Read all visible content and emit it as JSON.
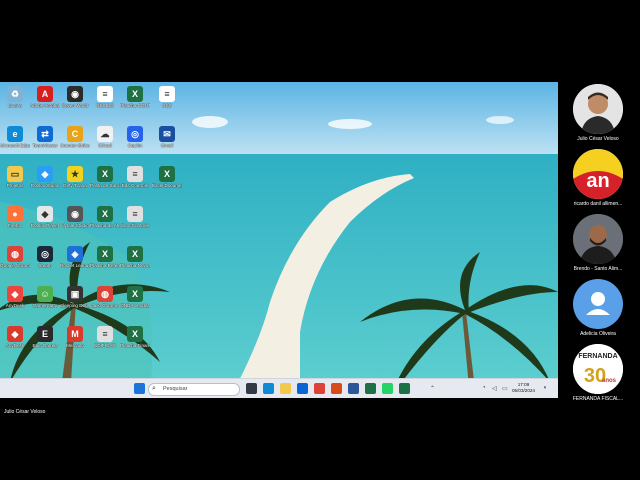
{
  "desktop": {
    "icons": [
      {
        "label": "Lixeira",
        "glyph": "♻",
        "color": "#7fb3d5"
      },
      {
        "label": "Adobe Acrobat",
        "glyph": "A",
        "color": "#d71f1f"
      },
      {
        "label": "Seven World",
        "glyph": "◉",
        "color": "#2b2b2b"
      },
      {
        "label": "RECIBO",
        "glyph": "≡",
        "color": "#ffffff"
      },
      {
        "label": "Planilha CONTROLE",
        "glyph": "X",
        "color": "#1e7145"
      },
      {
        "label": "CSS",
        "glyph": "≡",
        "color": "#ffffff"
      },
      {
        "label": "Microsoft Edge",
        "glyph": "e",
        "color": "#0f8bd6"
      },
      {
        "label": "TeamViewer",
        "glyph": "⇄",
        "color": "#0e6bd6"
      },
      {
        "label": "Counter-Strike 2",
        "glyph": "C",
        "color": "#e8a317"
      },
      {
        "label": "iCloud",
        "glyph": "☁",
        "color": "#f1f1f1"
      },
      {
        "label": "Copilot",
        "glyph": "◎",
        "color": "#2563eb"
      },
      {
        "label": "Gmail",
        "glyph": "✉",
        "color": "#1a4fa0"
      },
      {
        "label": "Projetos",
        "glyph": "▭",
        "color": "#f2c94c"
      },
      {
        "label": "Roblox Studio",
        "glyph": "◆",
        "color": "#2a9df4"
      },
      {
        "label": "Dirty Tirana",
        "glyph": "★",
        "color": "#f2d21e"
      },
      {
        "label": "Pasta de Sanches",
        "glyph": "X",
        "color": "#1e7145"
      },
      {
        "label": "Edit Controle",
        "glyph": "≡",
        "color": "#e0e0e0"
      },
      {
        "label": "Excel Documentos",
        "glyph": "X",
        "color": "#1e7145"
      },
      {
        "label": "Firefox",
        "glyph": "●",
        "color": "#ff7139"
      },
      {
        "label": "Roblox Player",
        "glyph": "◆",
        "color": "#e6e6e6"
      },
      {
        "label": "Hytale Studio",
        "glyph": "◉",
        "color": "#555555"
      },
      {
        "label": "Planilha de Atividades",
        "glyph": "X",
        "color": "#1e7145"
      },
      {
        "label": "Sam Controle",
        "glyph": "≡",
        "color": "#e0e0e0"
      },
      {
        "label": "Google Chrome",
        "glyph": "◍",
        "color": "#db4437"
      },
      {
        "label": "Steam",
        "glyph": "◎",
        "color": "#1b2838"
      },
      {
        "label": "Rocket League",
        "glyph": "◈",
        "color": "#1f6fd6"
      },
      {
        "label": "Planilha Reference de Operações",
        "glyph": "X",
        "color": "#1e7145"
      },
      {
        "label": "Planilha Novos",
        "glyph": "X",
        "color": "#1e7145"
      },
      {
        "label": "AnyDesk",
        "glyph": "◆",
        "color": "#ef443b"
      },
      {
        "label": "Gamerparty",
        "glyph": "☺",
        "color": "#4caf50"
      },
      {
        "label": "Sleeping Dogs",
        "glyph": "▣",
        "color": "#333333"
      },
      {
        "label": "Julio Chrome",
        "glyph": "◍",
        "color": "#db4437"
      },
      {
        "label": "ONDA Vendas",
        "glyph": "X",
        "color": "#1e7145"
      },
      {
        "label": "AnyDesk",
        "glyph": "◆",
        "color": "#d93a2b"
      },
      {
        "label": "Epic Games",
        "glyph": "E",
        "color": "#2a2a2a"
      },
      {
        "label": "Mercado",
        "glyph": "M",
        "color": "#d93a2b"
      },
      {
        "label": "EDIFICAR",
        "glyph": "≡",
        "color": "#e0e0e0"
      },
      {
        "label": "Planilha Financeira",
        "glyph": "X",
        "color": "#1e7145"
      }
    ]
  },
  "taskbar": {
    "search_placeholder": "Pesquisar",
    "time": "17:09",
    "date": "05/03/2024",
    "apps": [
      {
        "name": "task-view",
        "color": "#333a45"
      },
      {
        "name": "edge",
        "color": "#0f8bd6"
      },
      {
        "name": "file-explorer",
        "color": "#f2c94c"
      },
      {
        "name": "outlook",
        "color": "#0a64d6"
      },
      {
        "name": "chrome",
        "color": "#db4437"
      },
      {
        "name": "media",
        "color": "#d94b1a"
      },
      {
        "name": "word",
        "color": "#2b579a"
      },
      {
        "name": "excel-alt",
        "color": "#1e7145"
      },
      {
        "name": "whatsapp",
        "color": "#25d366"
      },
      {
        "name": "excel",
        "color": "#1e7145"
      }
    ]
  },
  "presenter": {
    "name": "Julio César Veloso"
  },
  "participants": [
    {
      "name": "Julio César Veloso",
      "avatar": "photo-man"
    },
    {
      "name": "ricardo danil allimen...",
      "avatar": "logo-an"
    },
    {
      "name": "Brendo - Santo Alim...",
      "avatar": "photo-bearded"
    },
    {
      "name": "Adelicia Oliveira",
      "avatar": "placeholder"
    },
    {
      "name": "FERNANDA FISCAL...",
      "avatar": "logo-fernanda",
      "logo_title": "FERNANDA",
      "logo_number": "30",
      "logo_sub": "anos"
    }
  ]
}
